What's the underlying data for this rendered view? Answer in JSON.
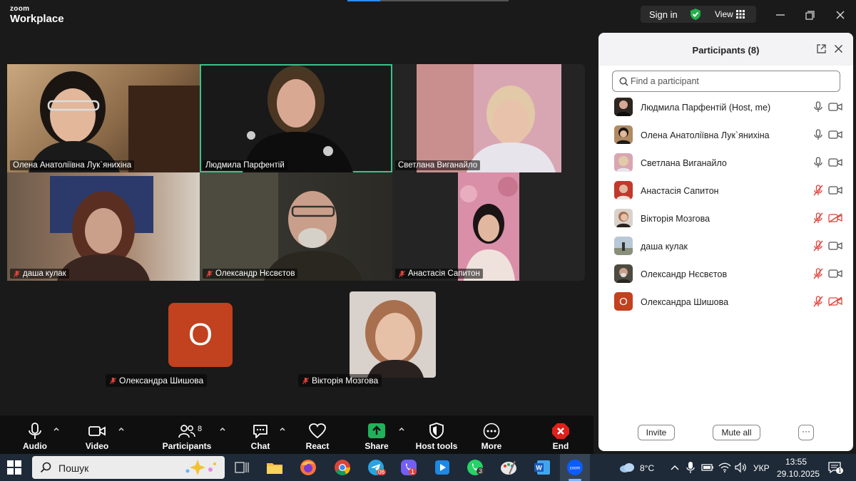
{
  "app": {
    "brand_small": "zoom",
    "brand_big": "Workplace"
  },
  "titlebar": {
    "sign_in": "Sign in",
    "view": "View"
  },
  "colors": {
    "accent_green": "#3ac28b",
    "zoom_blue": "#2d8cff",
    "avatar_orange": "#c2411f",
    "mic_muted_red": "#e0433b"
  },
  "gallery": {
    "tiles": [
      {
        "name": "Олена Анатоліївна Лук`янихіна",
        "muted": false,
        "active": false
      },
      {
        "name": "Людмила Парфентій",
        "muted": false,
        "active": true
      },
      {
        "name": "Светлана Виганайло",
        "muted": false,
        "active": false
      },
      {
        "name": "даша кулак",
        "muted": true,
        "active": false
      },
      {
        "name": "Олександр Нєсвєтов",
        "muted": true,
        "active": false
      },
      {
        "name": "Анастасія Сапитон",
        "muted": true,
        "active": false
      }
    ],
    "solo": [
      {
        "name": "Олександра Шишова",
        "avatar_letter": "O",
        "muted": true
      },
      {
        "name": "Вікторія Мозгова",
        "muted": true
      }
    ]
  },
  "toolbar": {
    "audio": "Audio",
    "video": "Video",
    "participants": "Participants",
    "participants_count": "8",
    "chat": "Chat",
    "react": "React",
    "share": "Share",
    "host_tools": "Host tools",
    "more": "More",
    "end": "End"
  },
  "panel": {
    "title": "Participants (8)",
    "search_placeholder": "Find a participant",
    "participants": [
      {
        "name": "Людмила Парфентій (Host, me)",
        "mic_muted": false,
        "cam_off": false
      },
      {
        "name": "Олена Анатоліївна Лук`янихіна",
        "mic_muted": false,
        "cam_off": false
      },
      {
        "name": "Светлана Виганайло",
        "mic_muted": false,
        "cam_off": false
      },
      {
        "name": "Анастасія Сапитон",
        "mic_muted": true,
        "cam_off": false
      },
      {
        "name": "Вікторія Мозгова",
        "mic_muted": true,
        "cam_off": true
      },
      {
        "name": "даша кулак",
        "mic_muted": true,
        "cam_off": false
      },
      {
        "name": "Олександр Нєсвєтов",
        "mic_muted": true,
        "cam_off": false
      },
      {
        "name": "Олександра Шишова",
        "mic_muted": true,
        "cam_off": true,
        "avatar_letter": "O"
      }
    ],
    "invite": "Invite",
    "mute_all": "Mute all",
    "more": "···"
  },
  "taskbar": {
    "search": "Пошук",
    "viber_badge": "1",
    "whatsapp_badge": "3",
    "telegram_badge": "06",
    "weather": "8°C",
    "lang": "УКР",
    "time": "13:55",
    "date": "29.10.2025",
    "notif_count": "1"
  }
}
